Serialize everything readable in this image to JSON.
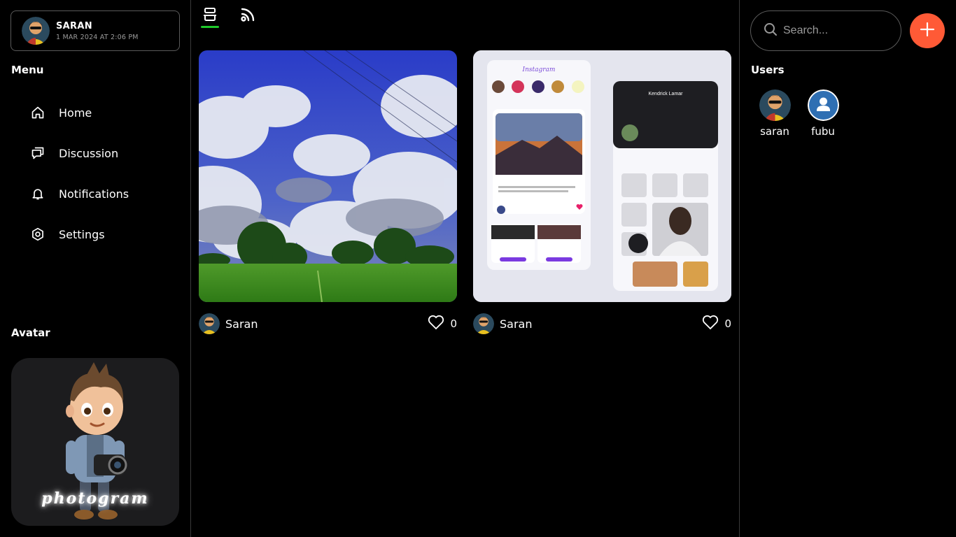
{
  "profile": {
    "name": "SARAN",
    "date": "1 MAR 2024 AT 2:06 PM"
  },
  "menu": {
    "title": "Menu",
    "items": [
      {
        "label": "Home",
        "icon": "home-icon"
      },
      {
        "label": "Discussion",
        "icon": "chat-icon"
      },
      {
        "label": "Notifications",
        "icon": "bell-icon"
      },
      {
        "label": "Settings",
        "icon": "settings-icon"
      }
    ]
  },
  "avatar_section": {
    "title": "Avatar",
    "brand": "photogram"
  },
  "tabs": [
    {
      "icon": "feed-icon",
      "active": true
    },
    {
      "icon": "rss-icon",
      "active": false
    }
  ],
  "posts": [
    {
      "author": "Saran",
      "likes": "0",
      "image": "landscape-sky-field"
    },
    {
      "author": "Saran",
      "likes": "0",
      "image": "instagram-app-mockup"
    }
  ],
  "search": {
    "placeholder": "Search..."
  },
  "users": {
    "title": "Users",
    "list": [
      {
        "name": "saran"
      },
      {
        "name": "fubu"
      }
    ]
  },
  "colors": {
    "accent_green": "#1ec82a",
    "add_button": "#ff5a36",
    "user_blue": "#2f6fb3"
  }
}
